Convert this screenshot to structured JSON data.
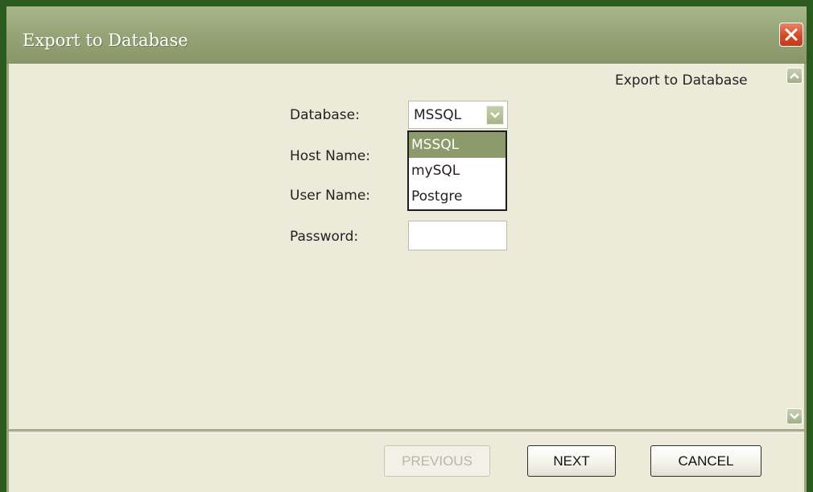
{
  "window": {
    "title": "Export to Database"
  },
  "content": {
    "header": "Export to Database"
  },
  "form": {
    "database_label": "Database:",
    "database_value": "MSSQL",
    "database_options": [
      "MSSQL",
      "mySQL",
      "Postgre"
    ],
    "host_label": "Host Name:",
    "user_label": "User Name:",
    "password_label": "Password:",
    "password_value": ""
  },
  "buttons": {
    "previous": "PREVIOUS",
    "next": "NEXT",
    "cancel": "CANCEL"
  },
  "colors": {
    "frame": "#98a678",
    "client_bg": "#ecebd9",
    "selected_option": "#8d9a6b",
    "close_button": "#d24a28"
  }
}
